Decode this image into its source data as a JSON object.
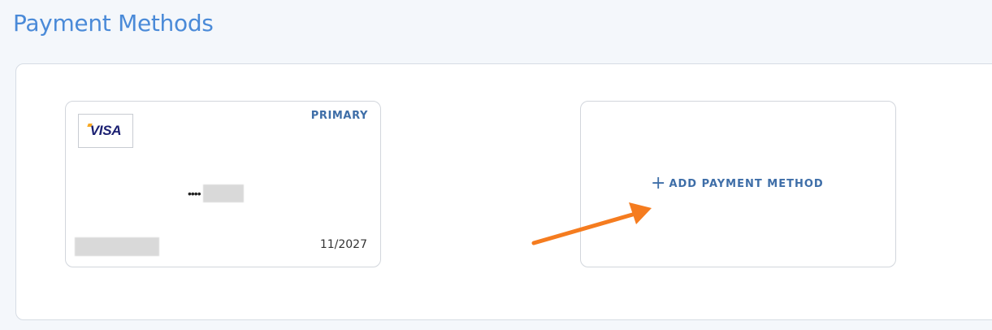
{
  "page": {
    "title": "Payment Methods"
  },
  "cards": [
    {
      "brand": "VISA",
      "brand_icon": "visa-logo-icon",
      "badge": "PRIMARY",
      "masked_number": "••••",
      "expiry": "11/2027"
    }
  ],
  "add_card": {
    "icon": "plus-icon",
    "label": "ADD PAYMENT METHOD"
  },
  "colors": {
    "title": "#4a8ad8",
    "accent": "#3e6ea8",
    "annotation_arrow": "#f57c1f",
    "background": "#f4f7fb"
  }
}
